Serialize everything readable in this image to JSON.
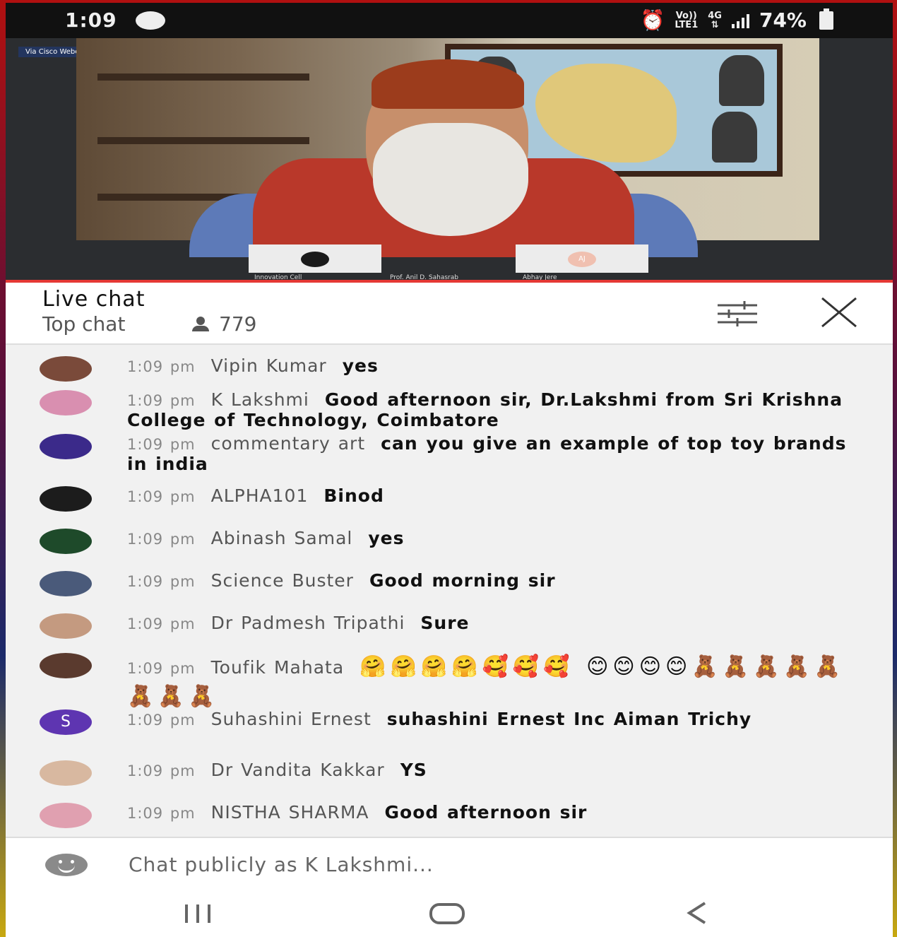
{
  "status_bar": {
    "time": "1:09",
    "network_volte": "Vo))",
    "network_lte": "LTE1",
    "network_4g": "4G",
    "battery": "74%"
  },
  "video": {
    "source_tag": "Via Cisco Webex",
    "participants": [
      "Innovation Cell",
      "Prof. Anil D. Sahasrab",
      "Abhay Jere"
    ],
    "participant_initials": "AJ"
  },
  "chat_header": {
    "title": "Live chat",
    "mode": "Top chat",
    "viewer_count": "779"
  },
  "messages": [
    {
      "time": "1:09 pm",
      "author": "Vipin Kumar",
      "text": "yes",
      "avatar_color": "#7a4a3a"
    },
    {
      "time": "1:09 pm",
      "author": "K Lakshmi",
      "text": "Good afternoon sir, Dr.Lakshmi from Sri Krishna College of Technology, Coimbatore",
      "avatar_color": "#d98fb0"
    },
    {
      "time": "1:09 pm",
      "author": "commentary art",
      "text": "can you give an example of top toy brands in india",
      "avatar_color": "#3b2a8a"
    },
    {
      "time": "1:09 pm",
      "author": "ALPHA101",
      "text": "Binod",
      "avatar_color": "#1c1c1c"
    },
    {
      "time": "1:09 pm",
      "author": "Abinash Samal",
      "text": "yes",
      "avatar_color": "#1e4a2a"
    },
    {
      "time": "1:09 pm",
      "author": "Science Buster",
      "text": "Good morning sir",
      "avatar_color": "#4a5a7a"
    },
    {
      "time": "1:09 pm",
      "author": "Dr Padmesh Tripathi",
      "text": "Sure",
      "avatar_color": "#c49a80"
    },
    {
      "time": "1:09 pm",
      "author": "Toufik Mahata",
      "text": "🤗🤗🤗🤗🥰🥰🥰 😊😊😊😊🧸🧸🧸🧸🧸🧸🧸🧸",
      "avatar_color": "#5a3a2e"
    },
    {
      "time": "1:09 pm",
      "author": "Suhashini Ernest",
      "text": "suhashini Ernest Inc Aiman Trichy",
      "avatar_letter": "S",
      "avatar_color": "#5e35b1"
    },
    {
      "time": "1:09 pm",
      "author": "Dr Vandita Kakkar",
      "text": "YS",
      "avatar_color": "#d8b8a0"
    },
    {
      "time": "1:09 pm",
      "author": "NISTHA SHARMA",
      "text": "Good afternoon sir",
      "avatar_color": "#e0a0b0"
    }
  ],
  "input": {
    "placeholder": "Chat publicly as K Lakshmi..."
  },
  "icons": {
    "filter": "tune-icon",
    "close": "close-icon",
    "emoji": "emoji-icon",
    "nav_recents": "recents-icon",
    "nav_home": "home-icon",
    "nav_back": "back-icon"
  },
  "colors": {
    "accent_red": "#e53935",
    "suhashini_avatar": "#5e35b1"
  }
}
